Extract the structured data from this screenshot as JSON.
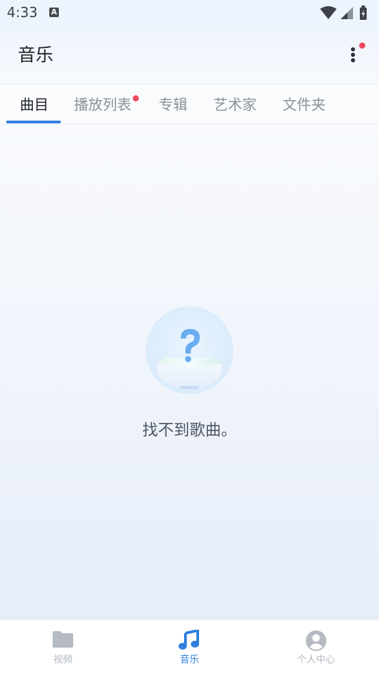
{
  "status_bar": {
    "time": "4:33",
    "notification_icon": "A",
    "icons": [
      "wifi-icon",
      "signal-icon",
      "battery-charging-icon"
    ]
  },
  "app_bar": {
    "title": "音乐",
    "menu_icon": "more-vert-icon",
    "menu_has_badge": true
  },
  "tabs": [
    {
      "label": "曲目",
      "active": true
    },
    {
      "label": "播放列表",
      "active": false,
      "badge": true
    },
    {
      "label": "专辑",
      "active": false
    },
    {
      "label": "艺术家",
      "active": false
    },
    {
      "label": "文件夹",
      "active": false
    }
  ],
  "empty_state": {
    "icon": "empty-box-question-icon",
    "message": "找不到歌曲。"
  },
  "bottom_nav": [
    {
      "label": "视频",
      "icon": "folder-icon",
      "active": false
    },
    {
      "label": "音乐",
      "icon": "music-note-icon",
      "active": true
    },
    {
      "label": "个人中心",
      "icon": "profile-icon",
      "active": false
    }
  ],
  "colors": {
    "accent": "#2f7fe0",
    "badge": "#ee4b5e",
    "inactive_tab": "#8a919c",
    "inactive_nav": "#b3b8c1"
  }
}
